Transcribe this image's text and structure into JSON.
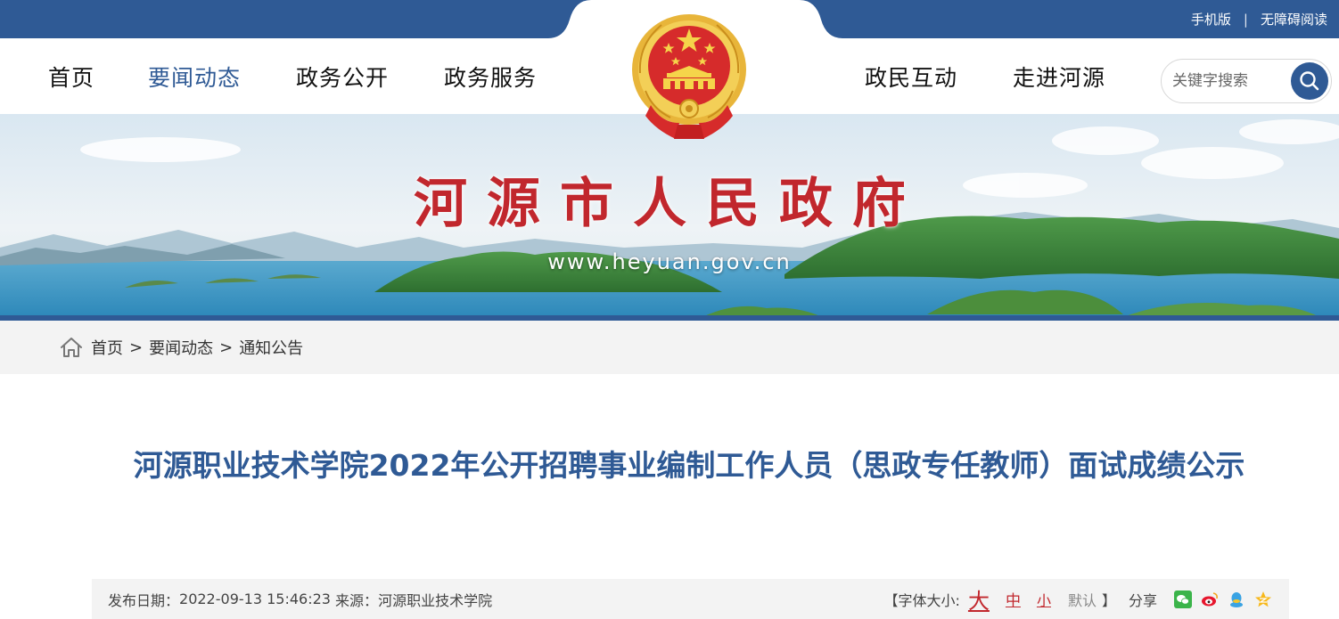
{
  "top_links": {
    "mobile": "手机版",
    "separator": "|",
    "accessibility": "无障碍阅读"
  },
  "nav": {
    "left": [
      {
        "label": "首页"
      },
      {
        "label": "要闻动态"
      },
      {
        "label": "政务公开"
      },
      {
        "label": "政务服务"
      }
    ],
    "right": [
      {
        "label": "政民互动"
      },
      {
        "label": "走进河源"
      }
    ],
    "active": "要闻动态"
  },
  "search": {
    "placeholder": "关键字搜索",
    "icon": "search-icon"
  },
  "emblem": {
    "icon": "national-emblem-icon"
  },
  "banner": {
    "title": "河源市人民政府",
    "url": "www.heyuan.gov.cn"
  },
  "breadcrumb": {
    "home_icon": "home-icon",
    "items": [
      "首页",
      "要闻动态",
      "通知公告"
    ],
    "separator": ">"
  },
  "article": {
    "title": "河源职业技术学院2022年公开招聘事业编制工作人员（思政专任教师）面试成绩公示"
  },
  "meta": {
    "date_label": "发布日期：",
    "date_value": "2022-09-13 15:46:23",
    "source_label": "来源：",
    "source_value": "河源职业技术学院",
    "font_size_open": "【字体大小:",
    "font_big": "大",
    "font_mid": "中",
    "font_small": "小",
    "font_default": "默认",
    "font_size_close": "】",
    "share_label": "分享",
    "share_icons": [
      "wechat-icon",
      "weibo-icon",
      "qq-icon",
      "qzone-icon"
    ]
  },
  "colors": {
    "brand_blue": "#2f5a95",
    "title_red": "#c1272d",
    "bar_gray": "#f3f3f3"
  }
}
